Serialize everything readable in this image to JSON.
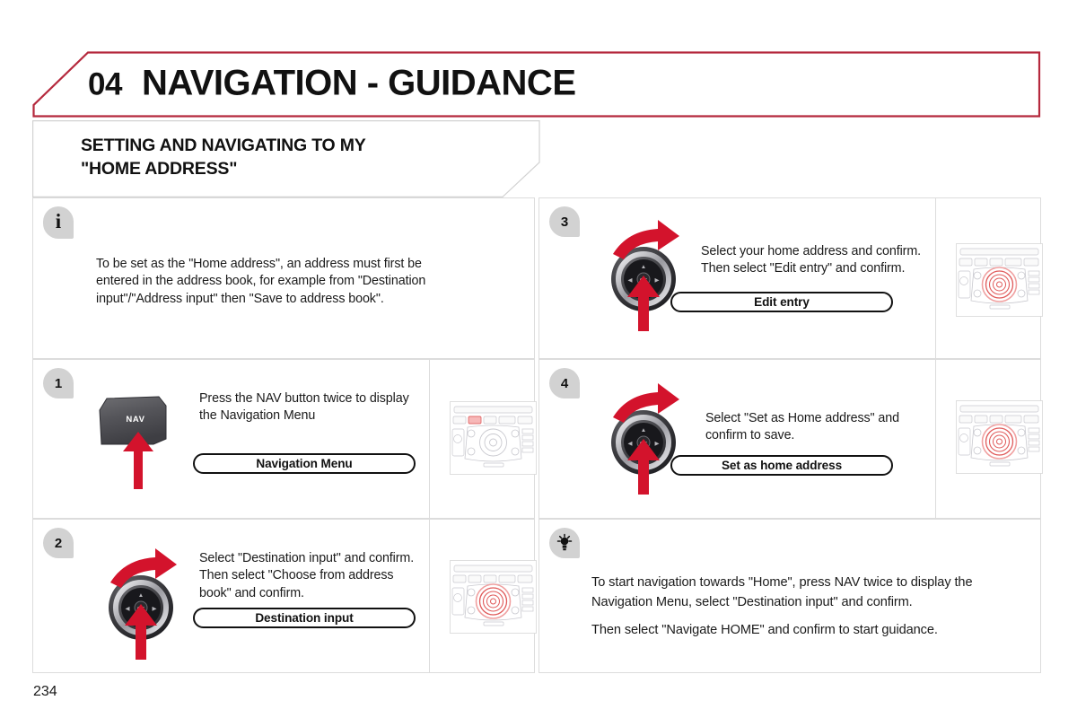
{
  "page": {
    "number": "234",
    "accent_color": "#b5293d",
    "badge_color": "#d2d2d2",
    "arrow_color": "#d3132c"
  },
  "header": {
    "chapter_number": "04",
    "title": "NAVIGATION - GUIDANCE"
  },
  "subtitle": {
    "text": "SETTING AND NAVIGATING TO MY\n\"HOME ADDRESS\""
  },
  "info_note": {
    "badge": "i",
    "icon": "info-icon",
    "text": "To be set as the \"Home address\", an address must first be\nentered in the address book, for example from \"Destination\ninput\"/\"Address input\" then \"Save to address book\"."
  },
  "steps": [
    {
      "badge": "1",
      "art": "nav-button",
      "text": "Press the NAV button twice to display\nthe Navigation Menu",
      "pill": "Navigation Menu",
      "thumb": "dashboard-nav-highlight",
      "button_label": "NAV"
    },
    {
      "badge": "2",
      "art": "rotary-knob",
      "text": "Select \"Destination input\" and confirm.\nThen select \"Choose from address\nbook\" and confirm.",
      "pill": "Destination input",
      "thumb": "dashboard-knob-highlight"
    },
    {
      "badge": "3",
      "art": "rotary-knob",
      "text": "Select your home address and confirm.\nThen select \"Edit entry\" and confirm.",
      "pill": "Edit entry",
      "thumb": "dashboard-knob-highlight"
    },
    {
      "badge": "4",
      "art": "rotary-knob",
      "text": "Select \"Set as Home address\" and\nconfirm to save.",
      "pill": "Set as home address",
      "thumb": "dashboard-knob-highlight"
    }
  ],
  "tip_note": {
    "icon": "lightbulb-icon",
    "line1": "To start navigation towards \"Home\", press NAV twice to display the Navigation Menu, select \"Destination input\" and confirm.",
    "line2": "Then select \"Navigate HOME\" and confirm to start guidance."
  }
}
